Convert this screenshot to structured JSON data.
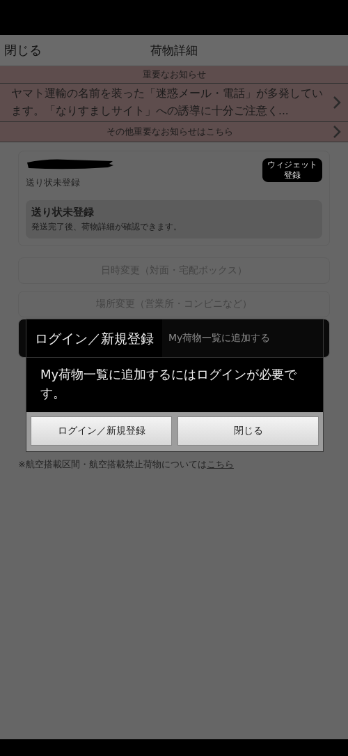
{
  "header": {
    "close": "閉じる",
    "title": "荷物詳細"
  },
  "notices": {
    "heading": "重要なお知らせ",
    "message": "ヤマト運輸の名前を装った「迷惑メール・電話」が多発しています。「なりすましサイト」への誘導に十分ご注意く...",
    "more": "その他重要なお知らせはこちら"
  },
  "package": {
    "status": "送り状未登録",
    "widget_button": "ウィジェット登録",
    "info_title": "送り状未登録",
    "info_text": "発送完了後、荷物詳細が確認できます。"
  },
  "actions": [
    {
      "label": "日時変更（対面・宅配ボックス）",
      "disabled": true
    },
    {
      "label": "場所変更（営業所・コンビニなど）",
      "disabled": true
    },
    {
      "label": "My荷物一覧に追加する",
      "disabled": false
    }
  ],
  "note": {
    "text": "※航空搭載区間・航空搭載禁止荷物については",
    "link": "こちら"
  },
  "dialog": {
    "title": "ログイン／新規登録",
    "message": "My荷物一覧に追加するにはログインが必要です。",
    "buttons": [
      "ログイン／新規登録",
      "閉じる"
    ]
  }
}
